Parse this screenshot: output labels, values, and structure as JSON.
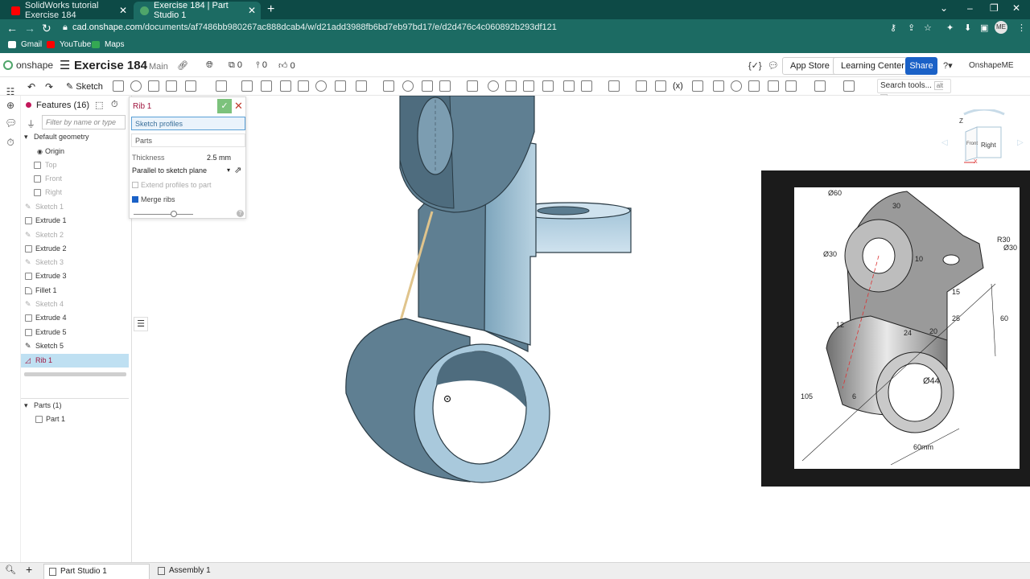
{
  "browser": {
    "tabs": [
      {
        "title": "SolidWorks tutorial Exercise 184",
        "active": false,
        "favicon_color": "#ff0000"
      },
      {
        "title": "Exercise 184 | Part Studio 1",
        "active": true,
        "favicon_color": "#4fa56a"
      }
    ],
    "url_prefix": "cad.onshape.com",
    "url_path": "/documents/af7486bb980267ac888dcab4/w/d21add3988fb6bd7eb97bd17/e/d2d476c4c060892b293df121",
    "bookmarks": [
      "Gmail",
      "YouTube",
      "Maps"
    ],
    "avatar": "ME"
  },
  "app": {
    "logo": "onshape",
    "doc_name": "Exercise 184",
    "branch": "Main",
    "counts": {
      "versions": "0",
      "branches": "0",
      "likes": "0"
    },
    "app_store": "App Store",
    "learning_center": "Learning Center",
    "share": "Share",
    "user": "OnshapeME",
    "fx_icon": "{✓}"
  },
  "toolbar": {
    "sketch_label": "Sketch",
    "search_tools": "Search tools...",
    "search_shortcut": "alt C"
  },
  "features": {
    "header": "Features (16)",
    "filter_placeholder": "Filter by name or type",
    "default_geometry": "Default geometry",
    "items": [
      {
        "label": "Origin",
        "dim": false,
        "selected": false
      },
      {
        "label": "Top",
        "dim": true,
        "selected": false
      },
      {
        "label": "Front",
        "dim": true,
        "selected": false
      },
      {
        "label": "Right",
        "dim": true,
        "selected": false
      },
      {
        "label": "Sketch 1",
        "dim": true,
        "selected": false
      },
      {
        "label": "Extrude 1",
        "dim": false,
        "selected": false
      },
      {
        "label": "Sketch 2",
        "dim": true,
        "selected": false
      },
      {
        "label": "Extrude 2",
        "dim": false,
        "selected": false
      },
      {
        "label": "Sketch 3",
        "dim": true,
        "selected": false
      },
      {
        "label": "Extrude 3",
        "dim": false,
        "selected": false
      },
      {
        "label": "Fillet 1",
        "dim": false,
        "selected": false
      },
      {
        "label": "Sketch 4",
        "dim": true,
        "selected": false
      },
      {
        "label": "Extrude 4",
        "dim": false,
        "selected": false
      },
      {
        "label": "Extrude 5",
        "dim": false,
        "selected": false
      },
      {
        "label": "Sketch 5",
        "dim": false,
        "selected": false
      },
      {
        "label": "Rib 1",
        "dim": false,
        "selected": true
      }
    ],
    "parts_header": "Parts (1)",
    "parts": [
      "Part 1"
    ]
  },
  "rib_dialog": {
    "title": "Rib 1",
    "sketch_profiles": "Sketch profiles",
    "parts": "Parts",
    "thickness_label": "Thickness",
    "thickness_value": "2.5 mm",
    "direction": "Parallel to sketch plane",
    "extend_label": "Extend profiles to part",
    "extend_checked": false,
    "merge_label": "Merge ribs",
    "merge_checked": true
  },
  "viewcube": {
    "front": "Front",
    "right": "Right",
    "z": "Z",
    "x": "X"
  },
  "reference_drawing": {
    "dims": [
      "Ø60",
      "30",
      "R30",
      "Ø30",
      "10",
      "Ø30",
      "15",
      "60",
      "12",
      "24",
      "20",
      "25",
      "105",
      "6",
      "Ø44",
      "60mm"
    ]
  },
  "bottom_tabs": [
    {
      "label": "Part Studio 1",
      "active": true
    },
    {
      "label": "Assembly 1",
      "active": false
    }
  ]
}
